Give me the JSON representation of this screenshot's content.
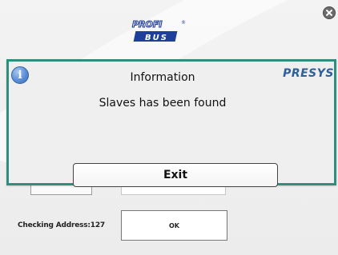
{
  "logo": {
    "top_word": "PROFI",
    "bottom_word": "BUS",
    "registered_mark": "®"
  },
  "close": {
    "icon": "close-icon"
  },
  "dialog": {
    "title": "Information",
    "brand": "PRESYS",
    "message": "Slaves has been found",
    "exit_label": "Exit",
    "icon": "info-icon",
    "icon_glyph": "i",
    "border_color": "#2f8f7f"
  },
  "background": {
    "checking_label": "Checking Address:127",
    "ok_label": "OK"
  }
}
